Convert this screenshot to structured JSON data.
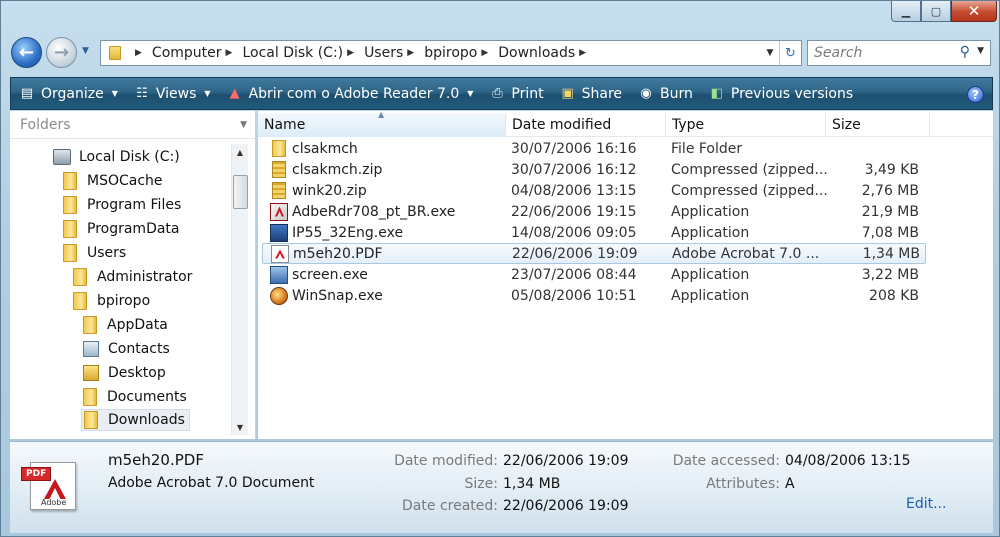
{
  "window": {
    "minimize_glyph": "▁",
    "maximize_glyph": "▢",
    "close_glyph": "✕"
  },
  "address": {
    "crumbs": [
      "Computer",
      "Local Disk (C:)",
      "Users",
      "bpiropo",
      "Downloads"
    ]
  },
  "search": {
    "placeholder": "Search"
  },
  "toolbar": {
    "organize": "Organize",
    "views": "Views",
    "open_with": "Abrir com o Adobe Reader 7.0",
    "print": "Print",
    "share": "Share",
    "burn": "Burn",
    "previous_versions": "Previous versions",
    "help": "?"
  },
  "folders": {
    "header": "Folders",
    "items": [
      {
        "label": "Local Disk (C:)",
        "icon": "drive-icon"
      },
      {
        "label": "MSOCache",
        "icon": "folder-icon"
      },
      {
        "label": "Program Files",
        "icon": "folder-icon"
      },
      {
        "label": "ProgramData",
        "icon": "folder-icon"
      },
      {
        "label": "Users",
        "icon": "folder-icon"
      },
      {
        "label": "Administrator",
        "icon": "folder-icon"
      },
      {
        "label": "bpiropo",
        "icon": "folder-icon"
      },
      {
        "label": "AppData",
        "icon": "folder-icon"
      },
      {
        "label": "Contacts",
        "icon": "contacts-icon"
      },
      {
        "label": "Desktop",
        "icon": "desktop-icon"
      },
      {
        "label": "Documents",
        "icon": "folder-icon"
      },
      {
        "label": "Downloads",
        "icon": "folder-icon"
      }
    ]
  },
  "files": {
    "columns": {
      "name": "Name",
      "date": "Date modified",
      "type": "Type",
      "size": "Size"
    },
    "rows": [
      {
        "name": "clsakmch",
        "date": "30/07/2006 16:16",
        "type": "File Folder",
        "size": "",
        "icon": "folder"
      },
      {
        "name": "clsakmch.zip",
        "date": "30/07/2006 16:12",
        "type": "Compressed (zipped...",
        "size": "3,49 KB",
        "icon": "zip"
      },
      {
        "name": "wink20.zip",
        "date": "04/08/2006 13:15",
        "type": "Compressed (zipped...",
        "size": "2,76 MB",
        "icon": "zip"
      },
      {
        "name": "AdbeRdr708_pt_BR.exe",
        "date": "22/06/2006 19:15",
        "type": "Application",
        "size": "21,9 MB",
        "icon": "adobe"
      },
      {
        "name": "IP55_32Eng.exe",
        "date": "14/08/2006 09:05",
        "type": "Application",
        "size": "7,08 MB",
        "icon": "app"
      },
      {
        "name": "m5eh20.PDF",
        "date": "22/06/2006 19:09",
        "type": "Adobe Acrobat 7.0 ...",
        "size": "1,34 MB",
        "icon": "pdf"
      },
      {
        "name": "screen.exe",
        "date": "23/07/2006 08:44",
        "type": "Application",
        "size": "3,22 MB",
        "icon": "screen"
      },
      {
        "name": "WinSnap.exe",
        "date": "05/08/2006 10:51",
        "type": "Application",
        "size": "208 KB",
        "icon": "winsnap"
      }
    ]
  },
  "details": {
    "filename": "m5eh20.PDF",
    "filetype": "Adobe Acrobat 7.0 Document",
    "icon_badge": "PDF",
    "icon_caption": "Adobe",
    "date_modified_label": "Date modified:",
    "date_modified": "22/06/2006 19:09",
    "size_label": "Size:",
    "size": "1,34 MB",
    "date_created_label": "Date created:",
    "date_created": "22/06/2006 19:09",
    "date_accessed_label": "Date accessed:",
    "date_accessed": "04/08/2006 13:15",
    "attributes_label": "Attributes:",
    "attributes": "A",
    "edit": "Edit..."
  }
}
